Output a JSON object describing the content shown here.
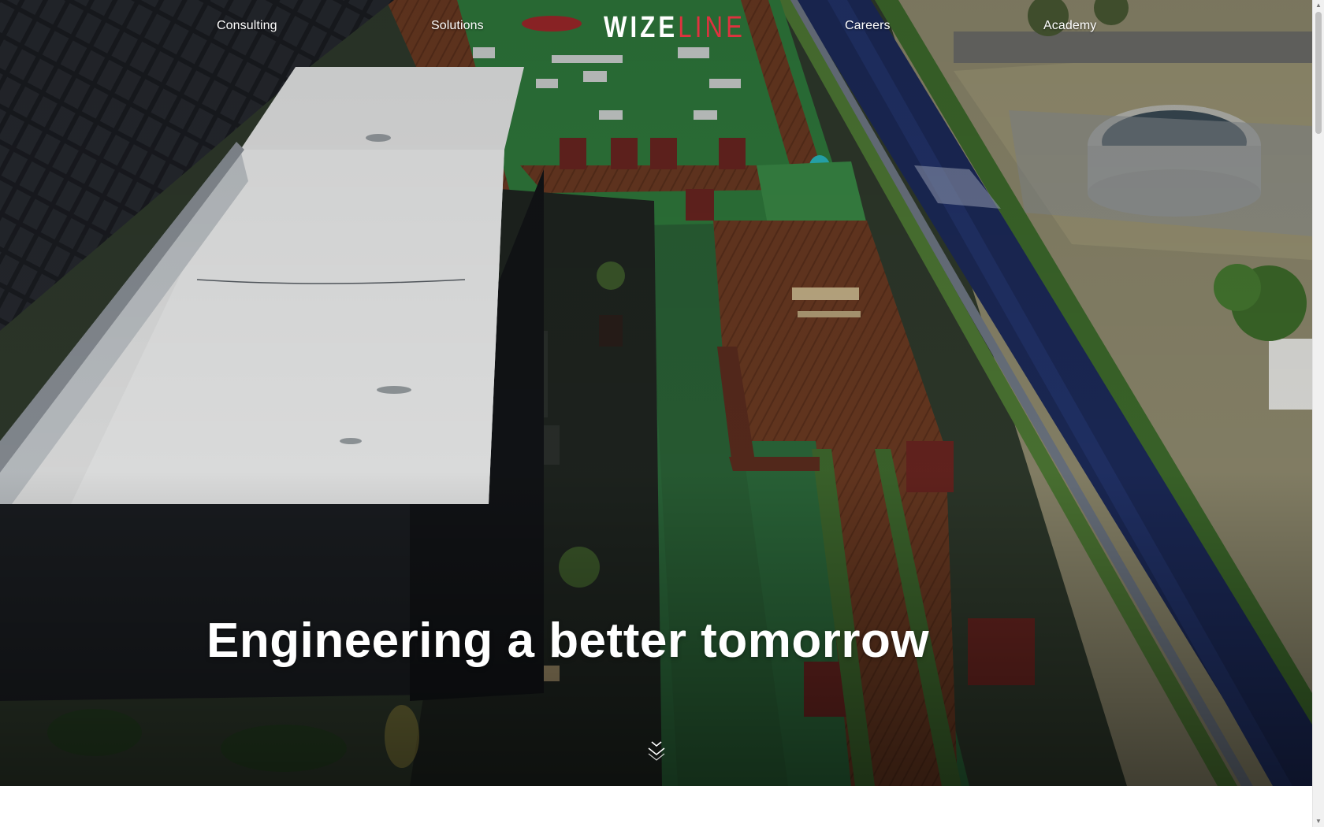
{
  "nav": {
    "items": [
      {
        "label": "Consulting"
      },
      {
        "label": "Solutions"
      },
      {
        "label": "Careers"
      },
      {
        "label": "Academy"
      }
    ],
    "logo": {
      "part_white": "WIZE",
      "part_red": "LINE",
      "accent_color": "#e0323f"
    }
  },
  "hero": {
    "headline": "Engineering a better tomorrow",
    "background": "aerial-rooftop-garden-photo",
    "scroll_icon": "double-chevron-down-icon"
  },
  "scrollbar": {
    "up_arrow": "▲",
    "down_arrow": "▼"
  }
}
